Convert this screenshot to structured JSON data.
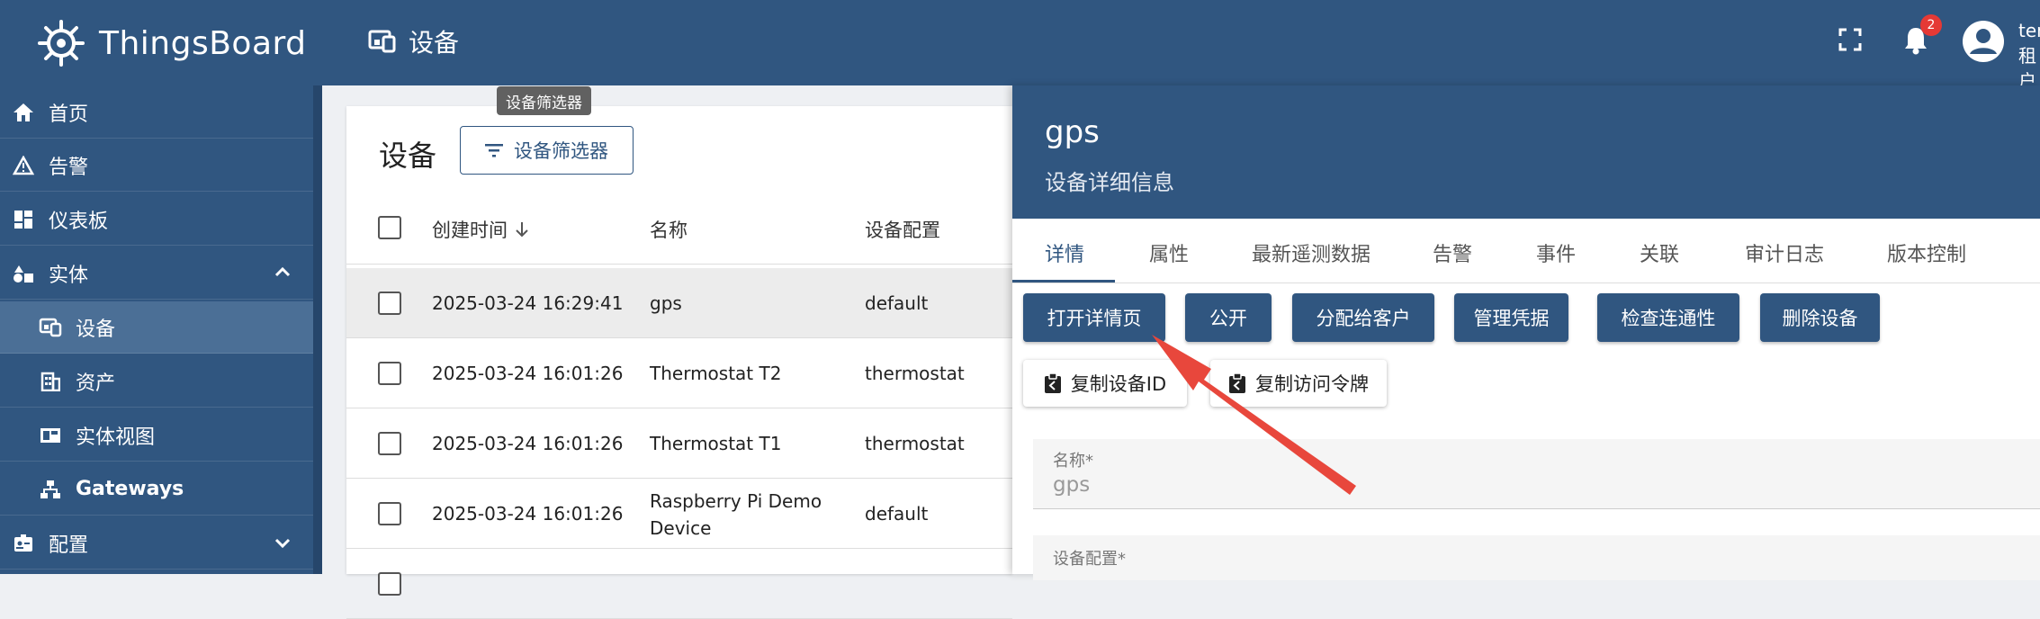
{
  "header": {
    "brand": "ThingsBoard",
    "page_title": "设备",
    "notification_count": "2",
    "user_name": "ten",
    "user_role": "租户"
  },
  "sidebar": {
    "items": [
      {
        "label": "首页",
        "icon": "home-icon"
      },
      {
        "label": "告警",
        "icon": "warning-icon"
      },
      {
        "label": "仪表板",
        "icon": "dashboard-icon"
      },
      {
        "label": "实体",
        "icon": "entities-icon"
      },
      {
        "label": "设备",
        "icon": "devices-icon"
      },
      {
        "label": "资产",
        "icon": "asset-icon"
      },
      {
        "label": "实体视图",
        "icon": "entity-view-icon"
      },
      {
        "label": "Gateways",
        "icon": "gateway-icon"
      },
      {
        "label": "配置",
        "icon": "profiles-icon"
      }
    ]
  },
  "main": {
    "tooltip": "设备筛选器",
    "title": "设备",
    "filter_button": "设备筛选器",
    "columns": [
      "创建时间",
      "名称",
      "设备配置"
    ],
    "rows": [
      {
        "created": "2025-03-24 16:29:41",
        "name": "gps",
        "profile": "default"
      },
      {
        "created": "2025-03-24 16:01:26",
        "name": "Thermostat T2",
        "profile": "thermostat"
      },
      {
        "created": "2025-03-24 16:01:26",
        "name": "Thermostat T1",
        "profile": "thermostat"
      },
      {
        "created": "2025-03-24 16:01:26",
        "name_line1": "Raspberry Pi Demo",
        "name_line2": "Device",
        "profile": "default"
      }
    ]
  },
  "detail": {
    "title": "gps",
    "subtitle": "设备详细信息",
    "tabs": [
      "详情",
      "属性",
      "最新遥测数据",
      "告警",
      "事件",
      "关联",
      "审计日志",
      "版本控制"
    ],
    "actions": [
      "打开详情页",
      "公开",
      "分配给客户",
      "管理凭据",
      "检查连通性",
      "删除设备"
    ],
    "copy_actions": [
      "复制设备ID",
      "复制访问令牌"
    ],
    "fields": [
      {
        "label": "名称*",
        "value": "gps"
      },
      {
        "label": "设备配置*",
        "value": ""
      }
    ]
  },
  "colors": {
    "primary": "#305680",
    "active_nav": "#4b6f96",
    "badge": "#e53935",
    "annotation_arrow": "#e8473c"
  }
}
